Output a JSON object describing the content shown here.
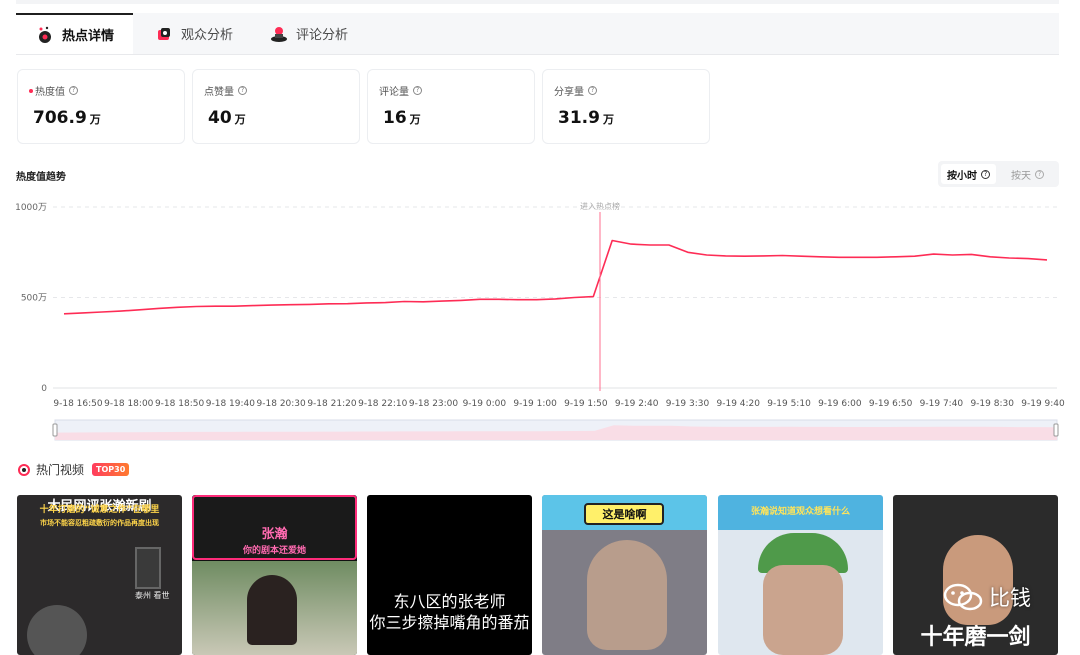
{
  "tabs": [
    {
      "label": "热点详情",
      "icon": "hot-detail-icon"
    },
    {
      "label": "观众分析",
      "icon": "audience-icon"
    },
    {
      "label": "评论分析",
      "icon": "comment-icon"
    }
  ],
  "metrics": [
    {
      "label": "热度值",
      "value": "706.9",
      "unit": "万"
    },
    {
      "label": "点赞量",
      "value": "40",
      "unit": "万"
    },
    {
      "label": "评论量",
      "value": "16",
      "unit": "万"
    },
    {
      "label": "分享量",
      "value": "31.9",
      "unit": "万"
    }
  ],
  "trend": {
    "title": "热度值趋势",
    "by_hour": "按小时",
    "by_day": "按天",
    "marker_label": "进入热点榜"
  },
  "chart_data": {
    "type": "line",
    "y_ticks": [
      "1000万",
      "500万",
      "0"
    ],
    "ylim": [
      0,
      1000
    ],
    "x_ticks": [
      "9-18 16:50",
      "9-18 18:00",
      "9-18 18:50",
      "9-18 19:40",
      "9-18 20:30",
      "9-18 21:20",
      "9-18 22:10",
      "9-18 23:00",
      "9-19 0:00",
      "9-19 1:00",
      "9-19 1:50",
      "9-19 2:40",
      "9-19 3:30",
      "9-19 4:20",
      "9-19 5:10",
      "9-19 6:00",
      "9-19 6:50",
      "9-19 7:40",
      "9-19 8:30",
      "9-19 9:40"
    ],
    "series": [
      {
        "values": [
          410,
          415,
          420,
          425,
          432,
          440,
          446,
          450,
          452,
          452,
          455,
          458,
          460,
          462,
          465,
          466,
          470,
          472,
          478,
          476,
          480,
          484,
          490,
          490,
          488,
          488,
          492,
          500,
          505,
          815,
          795,
          790,
          790,
          750,
          735,
          730,
          728,
          730,
          732,
          728,
          725,
          722,
          722,
          722,
          725,
          728,
          740,
          735,
          738,
          725,
          718,
          715,
          708
        ]
      }
    ],
    "marker_index": 27,
    "line_color": "#fe2c55",
    "grid": true
  },
  "hot_videos": {
    "title": "热门视频",
    "badge": "TOP30",
    "items": [
      {
        "lines": [
          "大民网评张瀚新剧",
          "十年打磨的“诚意之作”在哪里",
          "市场不能容忍粗疏敷衍的作品再度出现"
        ],
        "sub": "泰州 看世"
      },
      {
        "lines": [
          "张瀚",
          "你的剧本还爱她"
        ]
      },
      {
        "lines": [
          "东八区的张老师",
          "你三步擦掉嘴角的番茄"
        ]
      },
      {
        "lines": [
          "这是啥啊"
        ]
      },
      {
        "lines": [
          "张瀚说知道观众想看什么"
        ]
      },
      {
        "lines": [
          "十年磨一剑"
        ]
      }
    ]
  },
  "watermark": "比钱"
}
